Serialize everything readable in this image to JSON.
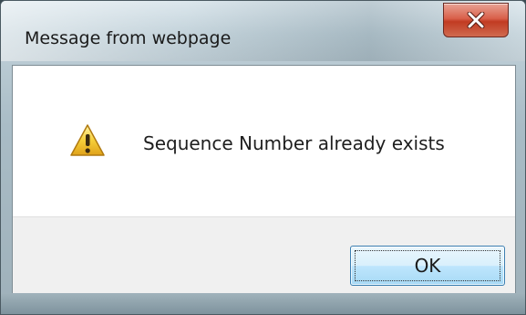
{
  "window": {
    "title": "Message from webpage",
    "close_icon": "close-x-icon"
  },
  "message": {
    "icon": "warning-triangle-icon",
    "text": "Sequence Number already exists"
  },
  "buttons": {
    "ok_label": "OK"
  },
  "colors": {
    "close_button": "#c94a33",
    "warning_icon": "#f2c230",
    "ok_button_border": "#3c7fb1"
  }
}
